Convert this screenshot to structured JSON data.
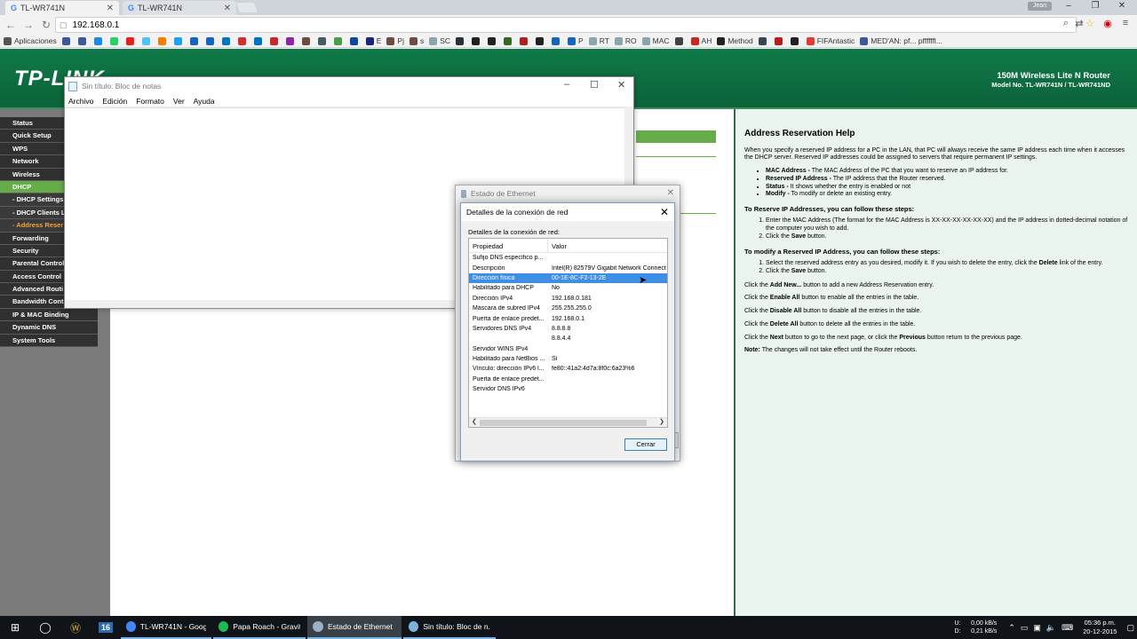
{
  "browser": {
    "tabs": [
      {
        "title": "TL-WR741N",
        "active": true
      },
      {
        "title": "TL-WR741N",
        "active": false
      }
    ],
    "user": "Jean",
    "url": "192.168.0.1",
    "bookmarks": [
      {
        "label": "Aplicaciones",
        "color": "#555555",
        "icon": "grid-icon"
      },
      {
        "label": "",
        "color": "#3b5998",
        "icon": "x-icon"
      },
      {
        "label": "",
        "color": "#3b5998",
        "icon": "facebook-icon"
      },
      {
        "label": "",
        "color": "#1e88e5",
        "icon": "doc-icon"
      },
      {
        "label": "",
        "color": "#25d366",
        "icon": "whatsapp-icon"
      },
      {
        "label": "",
        "color": "#e62117",
        "icon": "youtube-icon"
      },
      {
        "label": "",
        "color": "#4fc3f7",
        "icon": "circle-icon"
      },
      {
        "label": "",
        "color": "#f57c00",
        "icon": "circle-icon"
      },
      {
        "label": "",
        "color": "#1da1f2",
        "icon": "twitter-icon"
      },
      {
        "label": "",
        "color": "#1565c0",
        "icon": "cloud-icon"
      },
      {
        "label": "",
        "color": "#1565c0",
        "icon": "s-icon"
      },
      {
        "label": "",
        "color": "#0277bd",
        "icon": "scissors-icon"
      },
      {
        "label": "",
        "color": "#d32f2f",
        "icon": "gmail-icon"
      },
      {
        "label": "",
        "color": "#0072c6",
        "icon": "outlook-icon"
      },
      {
        "label": "",
        "color": "#c62828",
        "icon": "play-icon"
      },
      {
        "label": "",
        "color": "#8e24aa",
        "icon": "circle-icon"
      },
      {
        "label": "",
        "color": "#6d4c41",
        "icon": "circle-icon"
      },
      {
        "label": "",
        "color": "#455a64",
        "icon": "circle-icon"
      },
      {
        "label": "",
        "color": "#43a047",
        "icon": "leaf-icon"
      },
      {
        "label": "",
        "color": "#0d47a1",
        "icon": "square-icon"
      },
      {
        "label": "E",
        "color": "#1a237e",
        "icon": "square-icon"
      },
      {
        "label": "Pj",
        "color": "#6d4c41",
        "icon": "w-icon"
      },
      {
        "label": "s",
        "color": "#6d4c41",
        "icon": "w-icon"
      },
      {
        "label": "SC",
        "color": "#90a4ae",
        "icon": "page-icon"
      },
      {
        "label": "",
        "color": "#263238",
        "icon": "square-icon"
      },
      {
        "label": "",
        "color": "#212121",
        "icon": "cross-icon"
      },
      {
        "label": "",
        "color": "#212121",
        "icon": "square-icon"
      },
      {
        "label": "",
        "color": "#33691e",
        "icon": "circle-icon"
      },
      {
        "label": "",
        "color": "#b71c1c",
        "icon": "circle-icon"
      },
      {
        "label": "",
        "color": "#212121",
        "icon": "square-icon"
      },
      {
        "label": "",
        "color": "#1565c0",
        "icon": "square-icon"
      },
      {
        "label": "P",
        "color": "#1565c0",
        "icon": "square-icon"
      },
      {
        "label": "RT",
        "color": "#90a4ae",
        "icon": "page-icon"
      },
      {
        "label": "RO",
        "color": "#90a4ae",
        "icon": "g-icon"
      },
      {
        "label": "MAC",
        "color": "#90a4ae",
        "icon": "globe-icon"
      },
      {
        "label": "",
        "color": "#424242",
        "icon": "circle-icon"
      },
      {
        "label": "AH",
        "color": "#c62828",
        "icon": "circle-icon"
      },
      {
        "label": "Method",
        "color": "#212121",
        "icon": "w-icon"
      },
      {
        "label": "",
        "color": "#37474f",
        "icon": "fish-icon"
      },
      {
        "label": "",
        "color": "#b71c1c",
        "icon": "square-icon"
      },
      {
        "label": "",
        "color": "#212121",
        "icon": "square-icon"
      },
      {
        "label": "FIFAntastic",
        "color": "#e53935",
        "icon": "chart-icon"
      },
      {
        "label": "MED'AN: pf... pffffffl...",
        "color": "#3b5998",
        "icon": "facebook-icon"
      }
    ]
  },
  "router": {
    "logo": "TP-LINK",
    "title_line1": "150M Wireless Lite N Router",
    "title_line2": "Model No. TL-WR741N / TL-WR741ND",
    "menu": [
      {
        "label": "Status",
        "type": "main"
      },
      {
        "label": "Quick Setup",
        "type": "main"
      },
      {
        "label": "WPS",
        "type": "main"
      },
      {
        "label": "Network",
        "type": "main"
      },
      {
        "label": "Wireless",
        "type": "main"
      },
      {
        "label": "DHCP",
        "type": "active"
      },
      {
        "label": "- DHCP Settings",
        "type": "sub"
      },
      {
        "label": "- DHCP Clients Li",
        "type": "sub"
      },
      {
        "label": "- Address Reser",
        "type": "sub-active"
      },
      {
        "label": "Forwarding",
        "type": "main"
      },
      {
        "label": "Security",
        "type": "main"
      },
      {
        "label": "Parental Control",
        "type": "main"
      },
      {
        "label": "Access Control",
        "type": "main"
      },
      {
        "label": "Advanced Routi",
        "type": "main"
      },
      {
        "label": "Bandwidth Cont",
        "type": "main"
      },
      {
        "label": "IP & MAC Binding",
        "type": "main"
      },
      {
        "label": "Dynamic DNS",
        "type": "main"
      },
      {
        "label": "System Tools",
        "type": "main"
      }
    ],
    "help": {
      "title": "Address Reservation Help",
      "intro": "When you specify a reserved IP address for a PC in the LAN, that PC will always receive the same IP address each time when it accesses the DHCP server. Reserved IP addresses could be assigned to servers that require permanent IP settings.",
      "bullets": [
        {
          "term": "MAC Address -",
          "text": " The MAC Address of the PC that you want to reserve an IP address for."
        },
        {
          "term": "Reserved IP Address -",
          "text": " The IP address that the Router reserved."
        },
        {
          "term": "Status -",
          "text": " It shows whether the entry is enabled or not"
        },
        {
          "term": "Modify -",
          "text": " To modify or delete an existing entry."
        }
      ],
      "reserve_head": "To Reserve IP Addresses, you can follow these steps:",
      "reserve_step1": "Enter the MAC Address (The format for the MAC Address is XX-XX-XX-XX-XX-XX) and the IP address in dotted-decimal notation of the computer you wish to add.",
      "reserve_step2_pre": "Click the ",
      "reserve_step2_bold": "Save",
      "reserve_step2_post": " button.",
      "modify_head": "To modify a Reserved IP Address, you can follow these steps:",
      "modify_step1_pre": "Select the reserved address entry as you desired, modify it. If you wish to delete the entry, click the ",
      "modify_step1_bold": "Delete",
      "modify_step1_post": " link of the entry.",
      "modify_step2_pre": "Click the ",
      "modify_step2_bold": "Save",
      "modify_step2_post": " button.",
      "lines": [
        {
          "pre": "Click the ",
          "bold": "Add New...",
          "post": " button to add a new Address Reservation entry."
        },
        {
          "pre": "Click the ",
          "bold": "Enable All",
          "post": " button to enable all the entries in the table."
        },
        {
          "pre": "Click the ",
          "bold": "Disable All",
          "post": " button to disable all the entries in the table."
        },
        {
          "pre": "Click the ",
          "bold": "Delete All",
          "post": " button to delete all the entries in the table."
        }
      ],
      "next_pre": "Click the ",
      "next_bold": "Next",
      "next_mid": " button to go to the next page, or click the ",
      "next_bold2": "Previous",
      "next_post": " button return to the previous page.",
      "note_bold": "Note:",
      "note_text": " The changes will not take effect until the Router reboots."
    }
  },
  "notepad": {
    "title": "Sin título: Bloc de notas",
    "menu": [
      "Archivo",
      "Edición",
      "Formato",
      "Ver",
      "Ayuda"
    ]
  },
  "ethernet": {
    "title": "Estado de Ethernet"
  },
  "details": {
    "title": "Detalles de la conexión de red",
    "label": "Detalles de la conexión de red:",
    "col_property": "Propiedad",
    "col_value": "Valor",
    "rows": [
      {
        "prop": "Sufijo DNS específico p...",
        "val": ""
      },
      {
        "prop": "Descripción",
        "val": "Intel(R) 82579V Gigabit Network Connect"
      },
      {
        "prop": "Dirección física",
        "val": "00-1E-8C-F2-13-2E",
        "selected": true
      },
      {
        "prop": "Habilitado para DHCP",
        "val": "No"
      },
      {
        "prop": "Dirección IPv4",
        "val": "192.168.0.181"
      },
      {
        "prop": "Máscara de subred IPv4",
        "val": "255.255.255.0"
      },
      {
        "prop": "Puerta de enlace predet...",
        "val": "192.168.0.1"
      },
      {
        "prop": "Servidores DNS IPv4",
        "val": "8.8.8.8"
      },
      {
        "prop": "",
        "val": "8.8.4.4"
      },
      {
        "prop": "Servidor WINS IPv4",
        "val": ""
      },
      {
        "prop": "Habilitado para NetBios ...",
        "val": "Sí"
      },
      {
        "prop": "Vínculo: dirección IPv6 l...",
        "val": "fe80::41a2:4d7a:8f0c:6a23%6"
      },
      {
        "prop": "Puerta de enlace predet...",
        "val": ""
      },
      {
        "prop": "Servidor DNS IPv6",
        "val": ""
      }
    ],
    "close_button": "Cerrar"
  },
  "taskbar": {
    "apps": [
      {
        "label": "TL-WR741N - Goog...",
        "color": "#4285f4",
        "active": false
      },
      {
        "label": "Papa Roach - Gravity",
        "color": "#1db954",
        "active": false
      },
      {
        "label": "Estado de Ethernet",
        "color": "#9ab0c4",
        "active": true
      },
      {
        "label": "Sin título: Bloc de n...",
        "color": "#7cb3d6",
        "active": false
      }
    ],
    "pinned_16": "16",
    "net_up_label": "U:",
    "net_up": "0,00 kB/s",
    "net_down_label": "D:",
    "net_down": "0,21 kB/s",
    "time": "05:36 p.m.",
    "date": "20-12-2015"
  }
}
